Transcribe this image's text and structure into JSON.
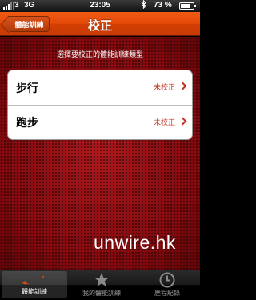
{
  "status_bar": {
    "carrier": "3",
    "network": "3G",
    "time": "23:05",
    "bluetooth_icon": "bluetooth-icon",
    "battery_percent": "73 %",
    "battery_level": 0.73
  },
  "nav": {
    "back_label": "體能訓練",
    "title": "校正"
  },
  "main": {
    "instruction": "選擇要校正的體能訓練類型",
    "items": [
      {
        "label": "步行",
        "status": "未校正"
      },
      {
        "label": "跑步",
        "status": "未校正"
      }
    ]
  },
  "watermark": "unwire.hk",
  "tabs": [
    {
      "label": "體能訓練",
      "icon": "swoosh-icon",
      "active": true
    },
    {
      "label": "我的體能訓練",
      "icon": "star-icon",
      "active": false
    },
    {
      "label": "歷程紀錄",
      "icon": "clock-icon",
      "active": false
    }
  ],
  "colors": {
    "accent": "#e54a08",
    "background": "#8a0d12",
    "status_text": "#c0311e"
  }
}
